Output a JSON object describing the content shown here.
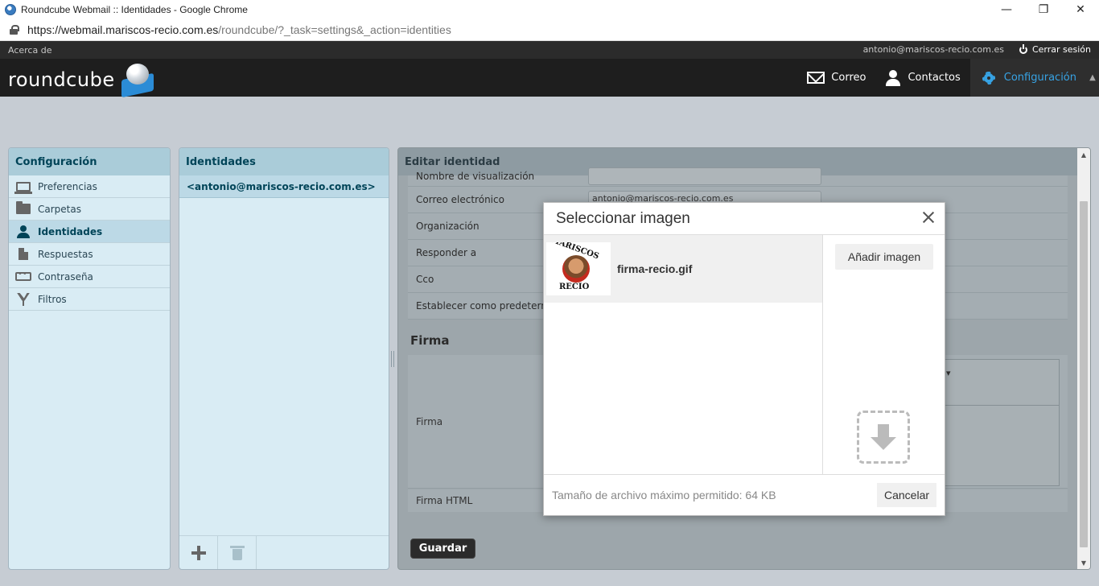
{
  "browser": {
    "title": "Roundcube Webmail :: Identidades - Google Chrome",
    "url_host": "https://webmail.mariscos-recio.com.es",
    "url_path": "/roundcube/?_task=settings&_action=identities",
    "window_controls": [
      "minimize-icon",
      "restore-icon",
      "close-icon"
    ]
  },
  "topline": {
    "about": "Acerca de",
    "user": "antonio@mariscos-recio.com.es",
    "logout": "Cerrar sesión"
  },
  "header": {
    "logo_text": "roundcube",
    "nav": [
      {
        "label": "Correo",
        "icon": "mail-icon"
      },
      {
        "label": "Contactos",
        "icon": "contacts-icon"
      },
      {
        "label": "Configuración",
        "icon": "gear-icon",
        "active": true
      }
    ],
    "accent": "#37a3e4"
  },
  "settings": {
    "title": "Configuración",
    "items": [
      {
        "label": "Preferencias",
        "icon": "monitor-icon"
      },
      {
        "label": "Carpetas",
        "icon": "folder-icon"
      },
      {
        "label": "Identidades",
        "icon": "user-icon",
        "active": true
      },
      {
        "label": "Respuestas",
        "icon": "document-icon"
      },
      {
        "label": "Contraseña",
        "icon": "password-icon"
      },
      {
        "label": "Filtros",
        "icon": "filter-icon"
      }
    ]
  },
  "identities": {
    "title": "Identidades",
    "items": [
      "<antonio@mariscos-recio.com.es>"
    ]
  },
  "edit": {
    "title": "Editar identidad",
    "fields": [
      {
        "label": "Nombre de visualización",
        "value": ""
      },
      {
        "label": "Correo electrónico",
        "value": "antonio@mariscos-recio.com.es"
      },
      {
        "label": "Organización",
        "value": ""
      },
      {
        "label": "Responder a",
        "value": ""
      },
      {
        "label": "Cco",
        "value": ""
      },
      {
        "label": "Establecer como predetermin",
        "value": ""
      }
    ],
    "signature_section": "Firma",
    "signature_label": "Firma",
    "html_signature_label": "Firma HTML",
    "save": "Guardar"
  },
  "dialog": {
    "title": "Seleccionar imagen",
    "images": [
      {
        "name": "firma-recio.gif",
        "thumb_top": "MARISCOS",
        "thumb_bottom": "RECIO"
      }
    ],
    "add_button": "Añadir imagen",
    "max_size": "Tamaño de archivo máximo permitido: 64 KB",
    "cancel": "Cancelar"
  }
}
